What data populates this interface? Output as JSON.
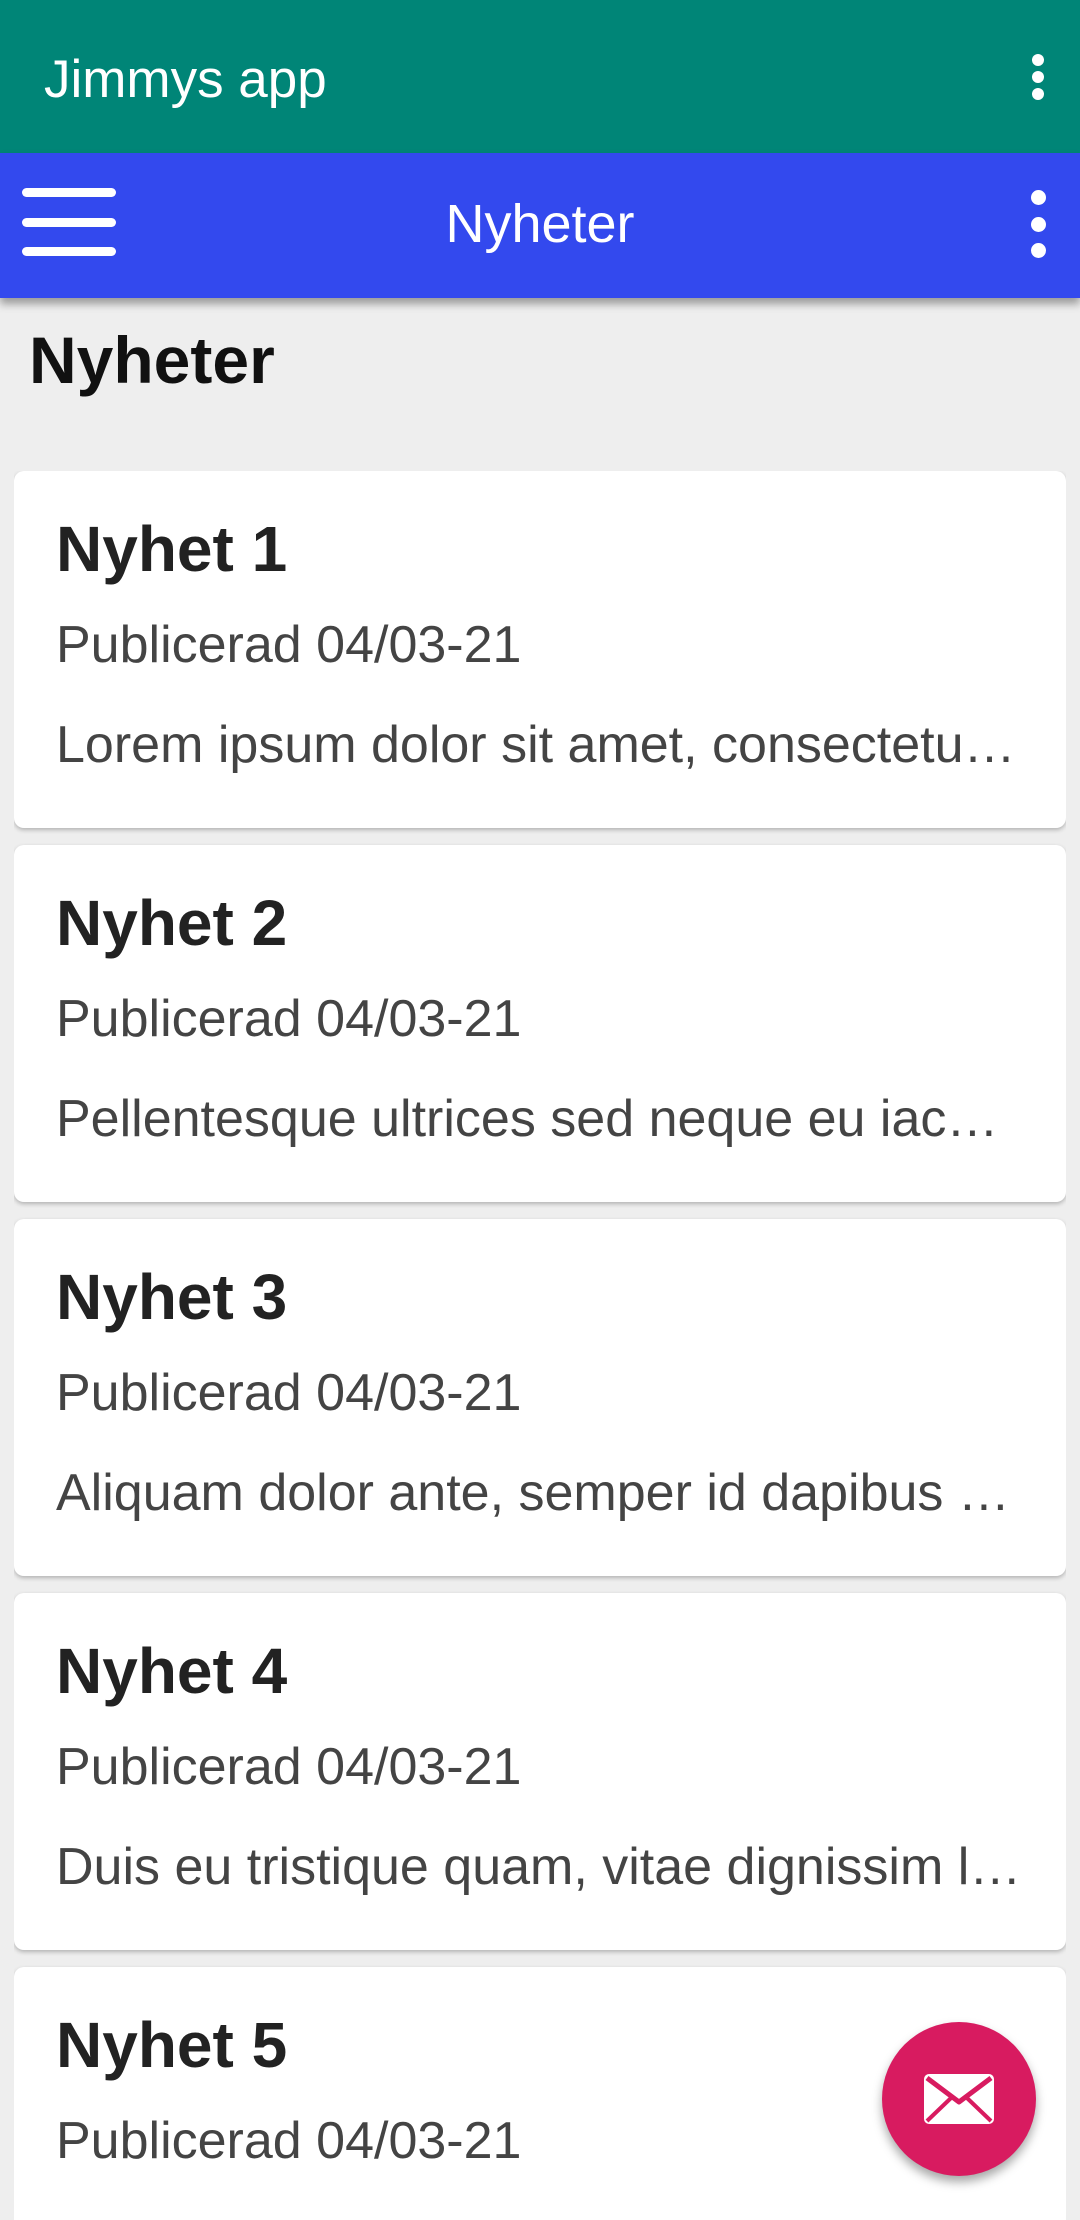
{
  "app": {
    "title": "Jimmys app"
  },
  "toolbar": {
    "title": "Nyheter"
  },
  "page": {
    "title": "Nyheter"
  },
  "news": [
    {
      "title": "Nyhet 1",
      "date": "Publicerad 04/03-21",
      "excerpt": "Lorem ipsum dolor sit amet, consectetur adipiscing elit."
    },
    {
      "title": "Nyhet 2",
      "date": "Publicerad 04/03-21",
      "excerpt": "Pellentesque ultrices sed neque eu iaculis."
    },
    {
      "title": "Nyhet 3",
      "date": "Publicerad 04/03-21",
      "excerpt": "Aliquam dolor ante, semper id dapibus nec."
    },
    {
      "title": "Nyhet 4",
      "date": "Publicerad 04/03-21",
      "excerpt": "Duis eu tristique quam, vitae dignissim lectus."
    },
    {
      "title": "Nyhet 5",
      "date": "Publicerad 04/03-21",
      "excerpt": ""
    }
  ],
  "icons": {
    "app_menu": "more-vert-icon",
    "toolbar_nav": "hamburger-menu-icon",
    "toolbar_menu": "more-vert-icon",
    "fab": "email-icon"
  },
  "colors": {
    "app_bar": "#008577",
    "toolbar": "#3349ee",
    "fab": "#d81b60",
    "background": "#eeeeee"
  }
}
